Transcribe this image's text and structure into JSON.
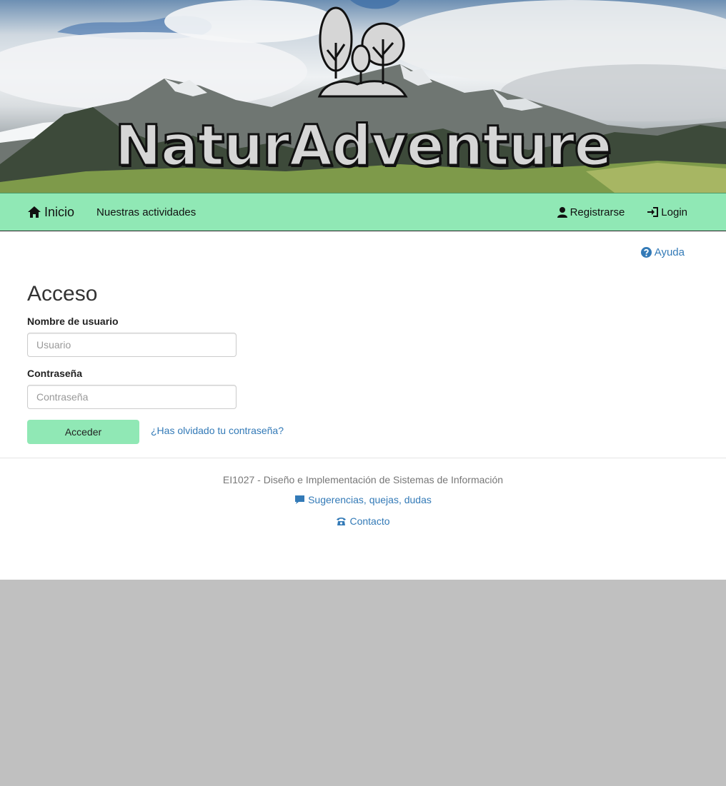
{
  "banner": {
    "logo_text": "NaturAdventure"
  },
  "navbar": {
    "home_label": "Inicio",
    "activities_label": "Nuestras actividades",
    "register_label": "Registrarse",
    "login_label": "Login"
  },
  "help_label": "Ayuda",
  "form": {
    "title": "Acceso",
    "username_label": "Nombre de usuario",
    "username_placeholder": "Usuario",
    "username_value": "",
    "password_label": "Contraseña",
    "password_placeholder": "Contraseña",
    "password_value": "",
    "submit_label": "Acceder",
    "forgot_label": "¿Has olvidado tu contraseña?"
  },
  "footer": {
    "course": "EI1027 - Diseño e Implementación de Sistemas de Información",
    "suggestions_label": "Sugerencias, quejas, dudas",
    "contact_label": "Contacto"
  },
  "colors": {
    "accent": "#90e8b5",
    "link": "#337ab7",
    "outside_background": "#c0c0c0"
  },
  "icons": {
    "home": "home-icon",
    "register": "user-icon",
    "login": "login-icon",
    "help": "question-circle-icon",
    "suggestions": "comment-icon",
    "contact": "phone-icon",
    "logo": "trees-logo-icon"
  }
}
